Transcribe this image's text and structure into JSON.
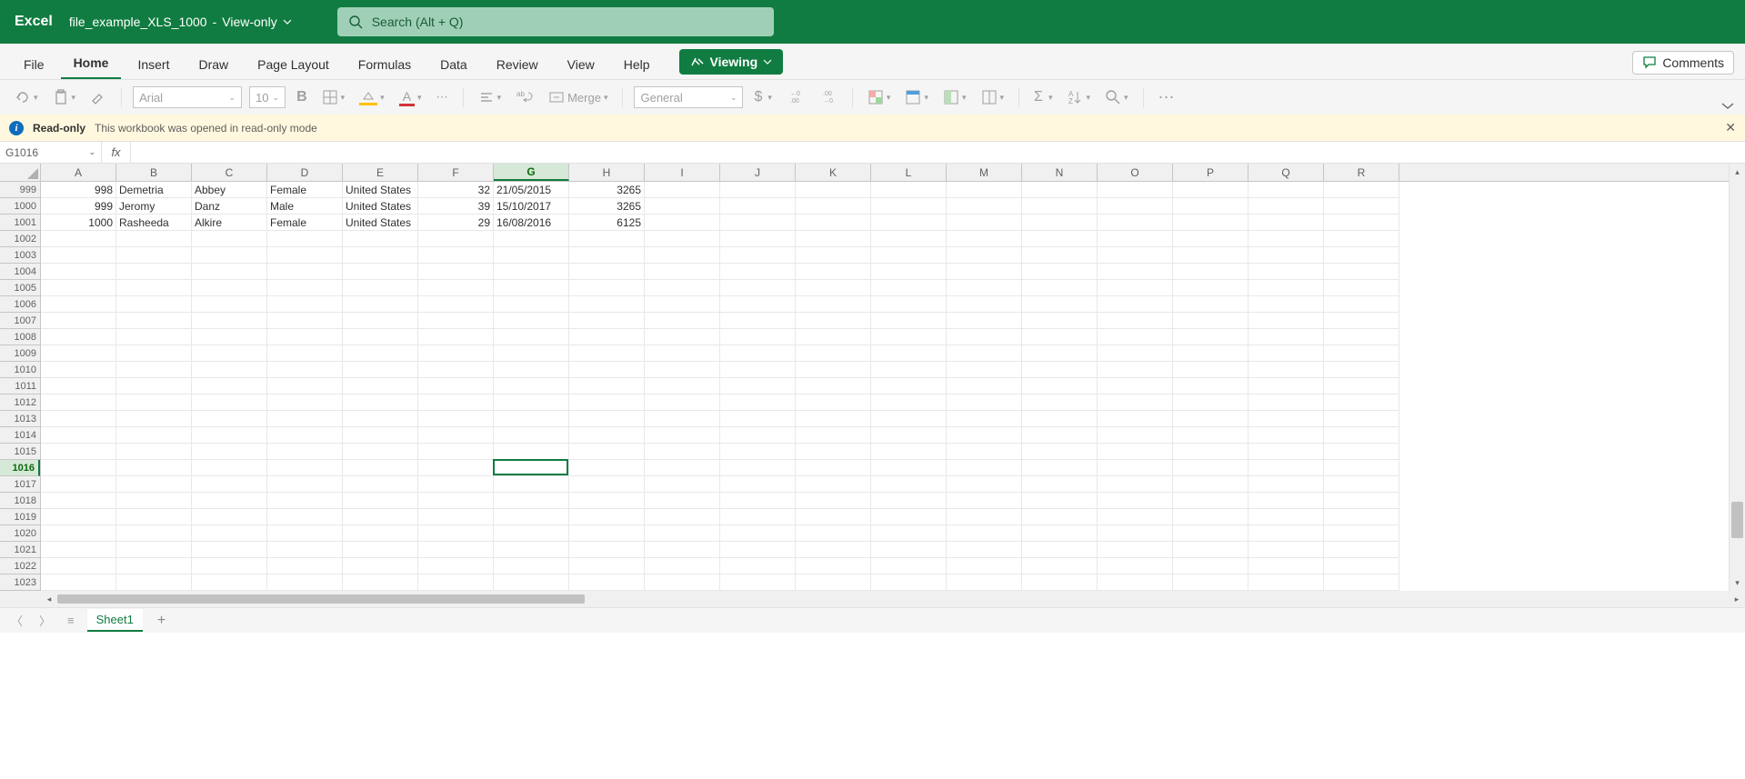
{
  "app": {
    "name": "Excel",
    "file": "file_example_XLS_1000",
    "mode": "View-only"
  },
  "search": {
    "placeholder": "Search (Alt + Q)"
  },
  "tabs": {
    "items": [
      "File",
      "Home",
      "Insert",
      "Draw",
      "Page Layout",
      "Formulas",
      "Data",
      "Review",
      "View",
      "Help"
    ],
    "active": "Home",
    "viewing": "Viewing",
    "comments": "Comments"
  },
  "toolbar": {
    "font_name": "Arial",
    "font_size": "10",
    "merge": "Merge",
    "number_format": "General"
  },
  "banner": {
    "title": "Read-only",
    "msg": "This workbook was opened in read-only mode"
  },
  "formula": {
    "cell_ref": "G1016",
    "fx": "fx",
    "value": ""
  },
  "grid": {
    "cols": [
      "A",
      "B",
      "C",
      "D",
      "E",
      "F",
      "G",
      "H",
      "I",
      "J",
      "K",
      "L",
      "M",
      "N",
      "O",
      "P",
      "Q",
      "R"
    ],
    "selected_col": "G",
    "row_start": 999,
    "row_end": 1023,
    "selected_row": 1016,
    "data_rows": [
      {
        "r": 999,
        "A": "998",
        "B": "Demetria",
        "C": "Abbey",
        "D": "Female",
        "E": "United States",
        "F": "32",
        "G": "21/05/2015",
        "H": "3265"
      },
      {
        "r": 1000,
        "A": "999",
        "B": "Jeromy",
        "C": "Danz",
        "D": "Male",
        "E": "United States",
        "F": "39",
        "G": "15/10/2017",
        "H": "3265"
      },
      {
        "r": 1001,
        "A": "1000",
        "B": "Rasheeda",
        "C": "Alkire",
        "D": "Female",
        "E": "United States",
        "F": "29",
        "G": "16/08/2016",
        "H": "6125"
      }
    ]
  },
  "sheet": {
    "name": "Sheet1"
  }
}
